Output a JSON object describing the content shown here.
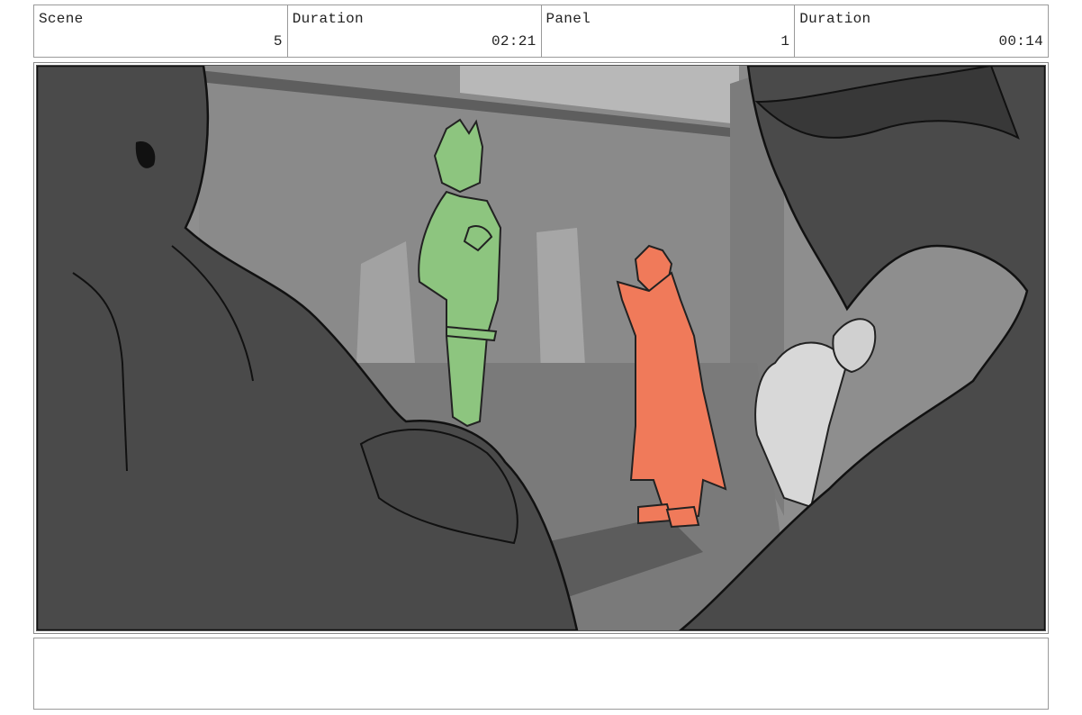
{
  "header": {
    "scene_label": "Scene",
    "scene_value": "5",
    "scene_duration_label": "Duration",
    "scene_duration_value": "02:21",
    "panel_label": "Panel",
    "panel_value": "1",
    "panel_duration_label": "Duration",
    "panel_duration_value": "00:14"
  },
  "panel": {
    "colors": {
      "green_character": "#8dc57f",
      "red_character": "#f07a5a",
      "foreground_silhouette": "#4a4a4a",
      "background_grey": "#8c8c8c"
    }
  },
  "notes": {
    "text": ""
  }
}
